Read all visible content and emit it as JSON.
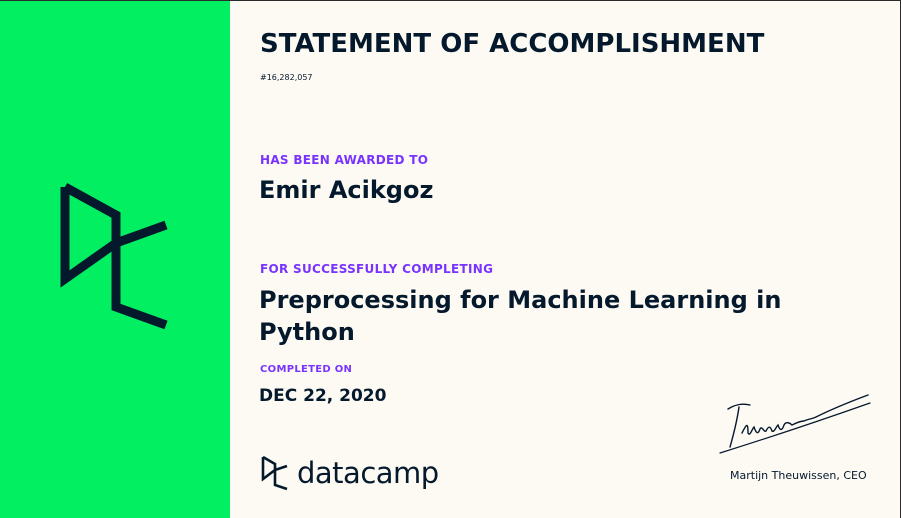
{
  "certificate": {
    "title": "STATEMENT OF ACCOMPLISHMENT",
    "id": "#16,282,057",
    "awarded_label": "HAS BEEN AWARDED TO",
    "recipient": "Emir Acikgoz",
    "completing_label": "FOR SUCCESSFULLY COMPLETING",
    "course_title": "Preprocessing for Machine Learning in Python",
    "completed_label": "COMPLETED ON",
    "completed_date": "DEC 22, 2020",
    "signer": "Martijn Theuwissen, CEO",
    "signature_text": "Theuwissen"
  },
  "brand": {
    "name": "datacamp",
    "logo_icon": "datacamp-logo-icon"
  },
  "colors": {
    "accent_green": "#03ef62",
    "label_purple": "#7933ff",
    "navy": "#05192d",
    "paper": "#fdfaf4"
  }
}
